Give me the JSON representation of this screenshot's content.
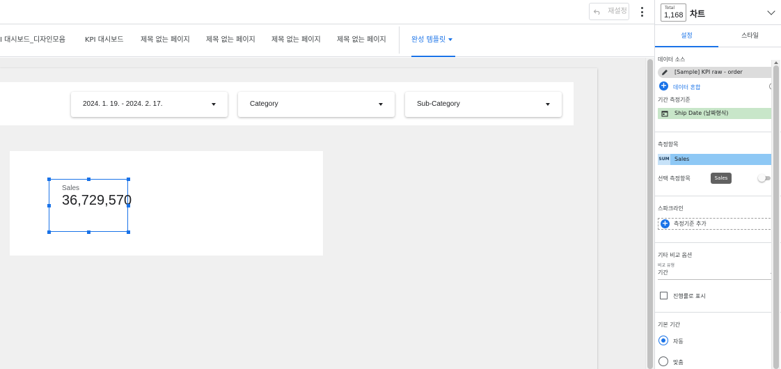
{
  "toolbar": {
    "reset_label": "재설정",
    "undo_icon": "undo-icon",
    "more_icon": "more-vert-icon"
  },
  "page_tabs": [
    {
      "label": "PI 대시보드_디자인모음"
    },
    {
      "label": "KPI 대시보드"
    },
    {
      "label": "제목 없는 페이지"
    },
    {
      "label": "제목 없는 페이지"
    },
    {
      "label": "제목 없는 페이지"
    },
    {
      "label": "제목 없는 페이지"
    },
    {
      "label": "완성 템플릿",
      "active": true
    }
  ],
  "filters": [
    {
      "label": "2024. 1. 19. - 2024. 2. 17."
    },
    {
      "label": "Category"
    },
    {
      "label": "Sub-Category"
    }
  ],
  "scorecard": {
    "metric_label": "Sales",
    "value": "36,729,570"
  },
  "panel": {
    "type_icon_top": "Total",
    "type_icon_value": "1,168",
    "title": "차트",
    "tabs": {
      "setup": "설정",
      "style": "스타일"
    },
    "data_source": {
      "section": "데이터 소스",
      "source_name": "[Sample] KPI raw - order",
      "blend_label": "데이터 혼합"
    },
    "date_range": {
      "section": "기간 측정기준",
      "dimension": "Ship Date (날짜형식)"
    },
    "metric": {
      "section": "측정항목",
      "aggregation": "SUM",
      "field": "Sales"
    },
    "optional_metrics": {
      "label": "선택 측정항목",
      "tooltip": "Sales",
      "enabled": false
    },
    "sparkline": {
      "section": "스파크라인",
      "add_label": "측정기준 추가"
    },
    "comparison": {
      "section": "기타 비교 옵션",
      "type_label": "비교 유형",
      "type_value": "기간",
      "progress_label": "진행률로 표시",
      "progress_checked": false
    },
    "default_range": {
      "section": "기본 기간",
      "options": [
        {
          "label": "자동",
          "selected": true
        },
        {
          "label": "맞춤",
          "selected": false
        }
      ]
    }
  },
  "colors": {
    "accent": "#1a73e8",
    "dimension_chip": "#c8e6c9",
    "metric_chip": "#8ec8f5"
  }
}
